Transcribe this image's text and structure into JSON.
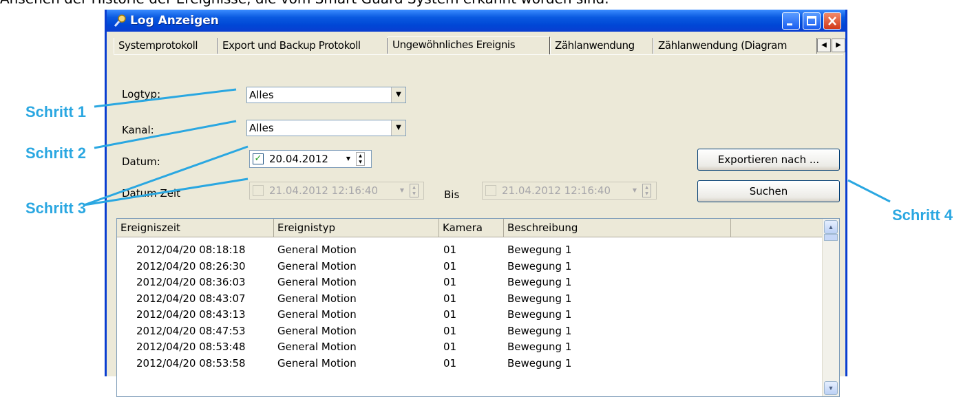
{
  "caption": "Ansehen der Historie der Ereignisse, die vom Smart Guard System erkannt worden sind.",
  "window": {
    "title": "Log Anzeigen",
    "icon": "search-icon",
    "controls": [
      "minimize-icon",
      "maximize-icon",
      "close-icon"
    ]
  },
  "tabs": [
    {
      "label": "Systemprotokoll",
      "active": false
    },
    {
      "label": "Export und Backup Protokoll",
      "active": false
    },
    {
      "label": "Ungewöhnliches Ereignis",
      "active": true
    },
    {
      "label": "Zählanwendung",
      "active": false
    },
    {
      "label": "Zählanwendung (Diagram",
      "active": false
    }
  ],
  "filters": {
    "logtyp_label": "Logtyp:",
    "logtyp_value": "Alles",
    "kanal_label": "Kanal:",
    "kanal_value": "Alles",
    "datum_label": "Datum:",
    "datum_value": "20.04.2012",
    "datum_checked": true,
    "datumzeit_label": "Datum Zeit",
    "datumzeit_from": "21.04.2012 12:16:40",
    "bis_label": "Bis",
    "datumzeit_to": "21.04.2012 12:16:40"
  },
  "buttons": {
    "export": "Exportieren nach ...",
    "search": "Suchen"
  },
  "table": {
    "columns": [
      "Ereigniszeit",
      "Ereignistyp",
      "Kamera",
      "Beschreibung"
    ],
    "rows": [
      [
        "2012/04/20 08:18:18",
        "General Motion",
        "01",
        "Bewegung 1"
      ],
      [
        "2012/04/20 08:26:30",
        "General Motion",
        "01",
        "Bewegung 1"
      ],
      [
        "2012/04/20 08:36:03",
        "General Motion",
        "01",
        "Bewegung 1"
      ],
      [
        "2012/04/20 08:43:07",
        "General Motion",
        "01",
        "Bewegung 1"
      ],
      [
        "2012/04/20 08:43:13",
        "General Motion",
        "01",
        "Bewegung 1"
      ],
      [
        "2012/04/20 08:47:53",
        "General Motion",
        "01",
        "Bewegung 1"
      ],
      [
        "2012/04/20 08:53:48",
        "General Motion",
        "01",
        "Bewegung 1"
      ],
      [
        "2012/04/20 08:53:58",
        "General Motion",
        "01",
        "Bewegung 1"
      ]
    ]
  },
  "annotations": {
    "step1": "Schritt 1",
    "step2": "Schritt 2",
    "step3": "Schritt 3",
    "step4": "Schritt 4",
    "color": "#2aa7e1"
  }
}
